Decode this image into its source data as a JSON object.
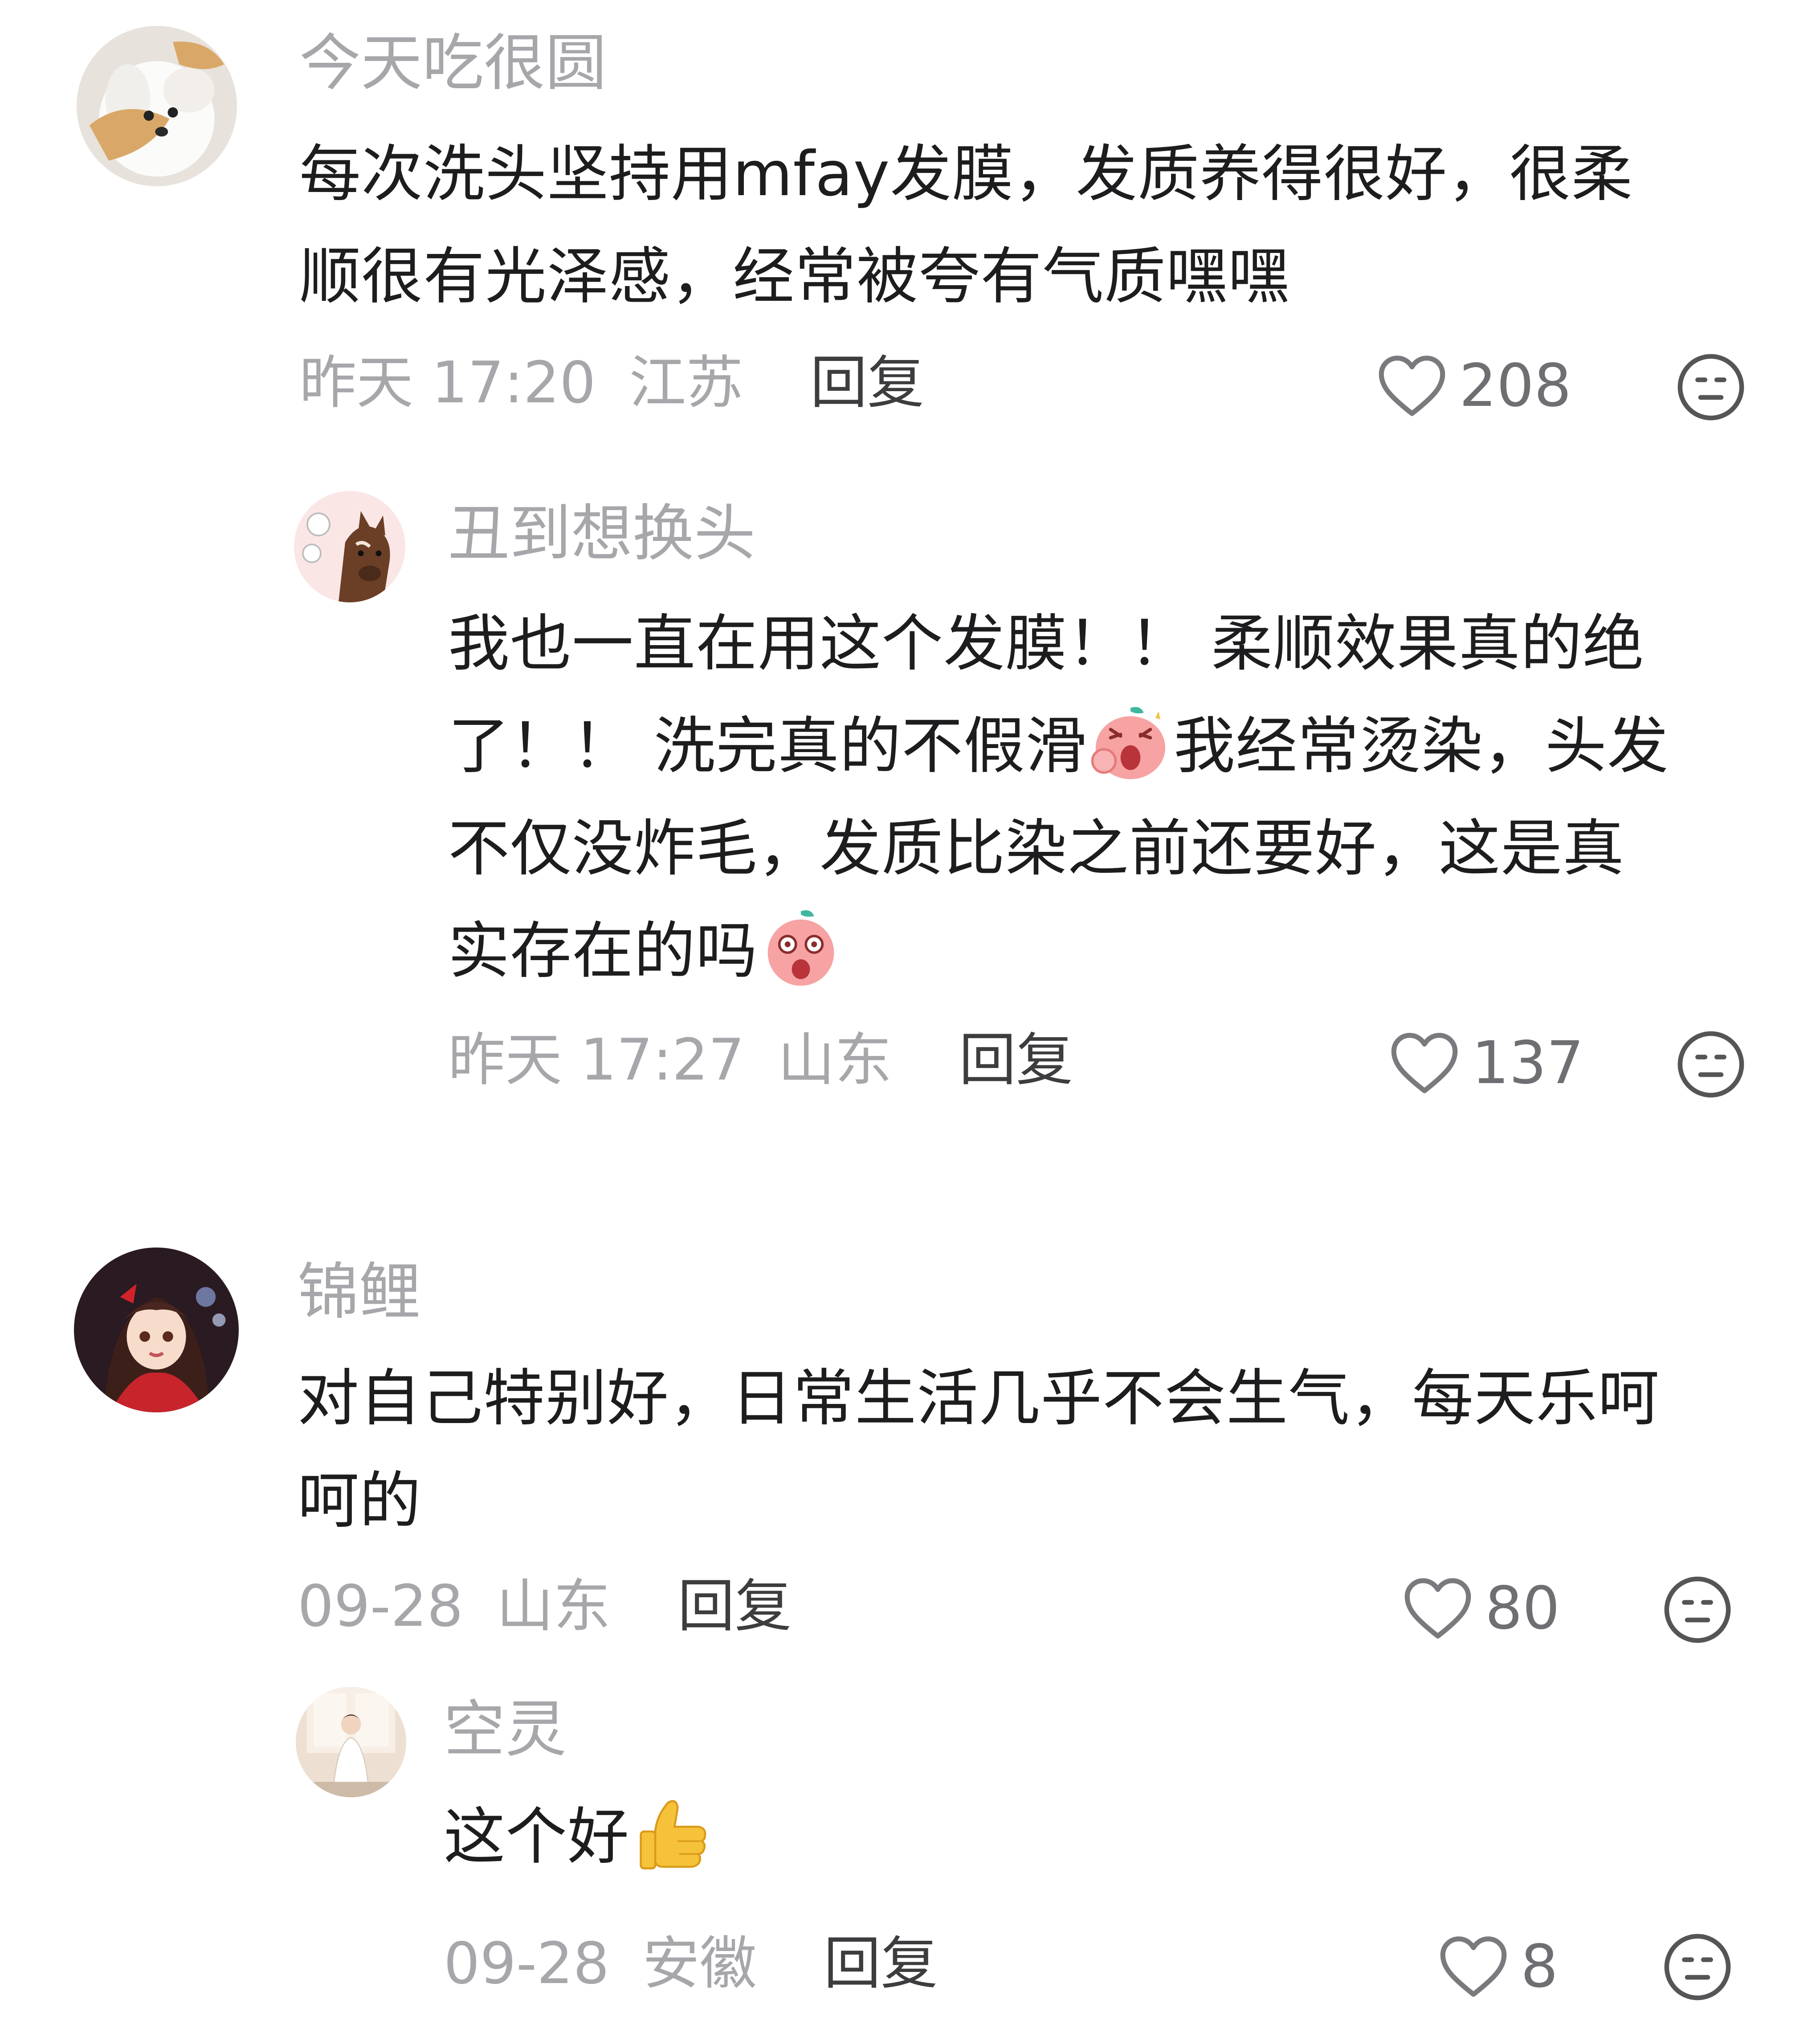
{
  "comments": [
    {
      "username": "今天吃很圆",
      "text_lines": [
        "每次洗头坚持用mfay发膜，发质养得很好，很柔",
        "顺很有光泽感，经常被夸有气质嘿嘿"
      ],
      "time": "昨天 17:20",
      "location": "江苏",
      "reply_label": "回复",
      "likes": "208"
    },
    {
      "username": "丑到想换头",
      "text_lines": [
        "我也一直在用这个发膜！！ 柔顺效果真的绝",
        "了！！ 洗完真的不假滑",
        "我经常烫染，头发",
        "不仅没炸毛，发质比染之前还要好，这是真",
        "实存在的吗"
      ],
      "time": "昨天 17:27",
      "location": "山东",
      "reply_label": "回复",
      "likes": "137"
    },
    {
      "username": "锦鲤",
      "text_lines": [
        "对自己特别好，日常生活几乎不会生气，每天乐呵",
        "呵的"
      ],
      "time": "09-28",
      "location": "山东",
      "reply_label": "回复",
      "likes": "80"
    },
    {
      "username": "空灵",
      "text_lines": [
        "这个好"
      ],
      "time": "09-28",
      "location": "安徽",
      "reply_label": "回复",
      "likes": "8"
    }
  ],
  "icons": {
    "like": "heart-outline-icon",
    "dislike": "neutral-face-icon",
    "emoji_shock": "peach-shock-emoji",
    "emoji_wow": "peach-wow-emoji",
    "emoji_thumbs": "thumbs-up-emoji"
  },
  "colors": {
    "username": "#a7a7ab",
    "body_text": "#1d1d1f",
    "meta": "#a7a7ab",
    "reply": "#3d3d40"
  }
}
